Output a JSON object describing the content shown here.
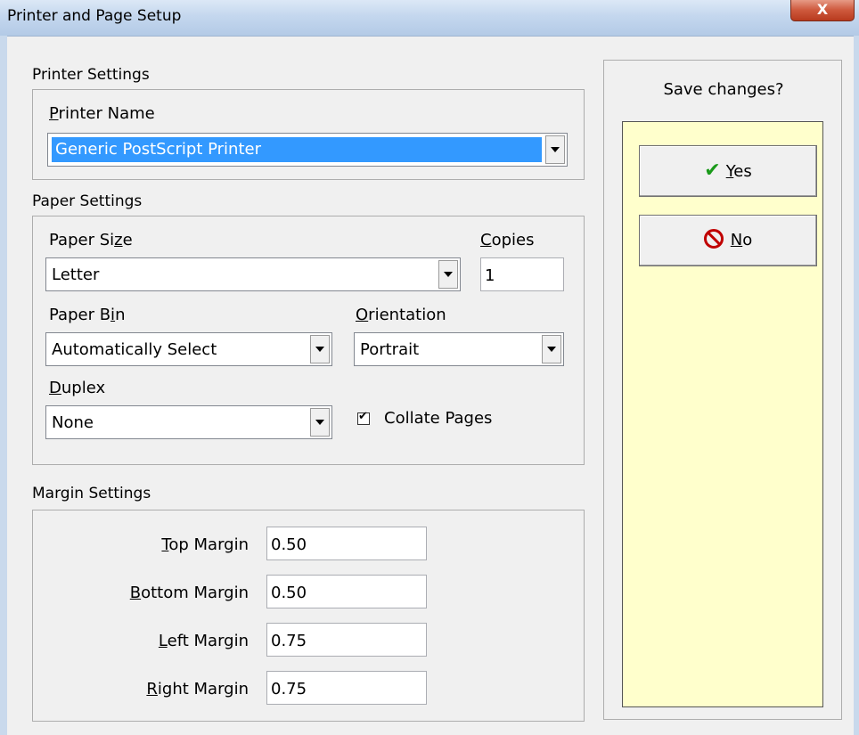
{
  "window": {
    "title": "Printer and Page Setup",
    "close_label": "X"
  },
  "printer_settings": {
    "section_label": "Printer Settings",
    "printer_name_label_pre": "",
    "printer_name_label_u": "P",
    "printer_name_label_post": "rinter Name",
    "printer_name_value": "Generic PostScript Printer"
  },
  "paper_settings": {
    "section_label": "Paper Settings",
    "paper_size_label_pre": "Paper Si",
    "paper_size_label_u": "z",
    "paper_size_label_post": "e",
    "paper_size_value": "Letter",
    "copies_label_u": "C",
    "copies_label_post": "opies",
    "copies_value": "1",
    "paper_bin_label_pre": "Paper B",
    "paper_bin_label_u": "i",
    "paper_bin_label_post": "n",
    "paper_bin_value": "Automatically Select",
    "orientation_label_u": "O",
    "orientation_label_post": "rientation",
    "orientation_value": "Portrait",
    "duplex_label_u": "D",
    "duplex_label_post": "uplex",
    "duplex_value": "None",
    "collate_label": "Collate Pages",
    "collate_checked": true
  },
  "margin_settings": {
    "section_label": "Margin Settings",
    "top_label_u": "T",
    "top_label_post": "op Margin",
    "top_value": "0.50",
    "bottom_label_u": "B",
    "bottom_label_post": "ottom Margin",
    "bottom_value": "0.50",
    "left_label_u": "L",
    "left_label_post": "eft Margin",
    "left_value": "0.75",
    "right_label_u": "R",
    "right_label_post": "ight Margin",
    "right_value": "0.75"
  },
  "save": {
    "title": "Save changes?",
    "yes_u": "Y",
    "yes_post": "es",
    "no_u": "N",
    "no_post": "o"
  },
  "colors": {
    "panel_yellow": "#ffffcc",
    "selection_blue": "#3399ff"
  }
}
